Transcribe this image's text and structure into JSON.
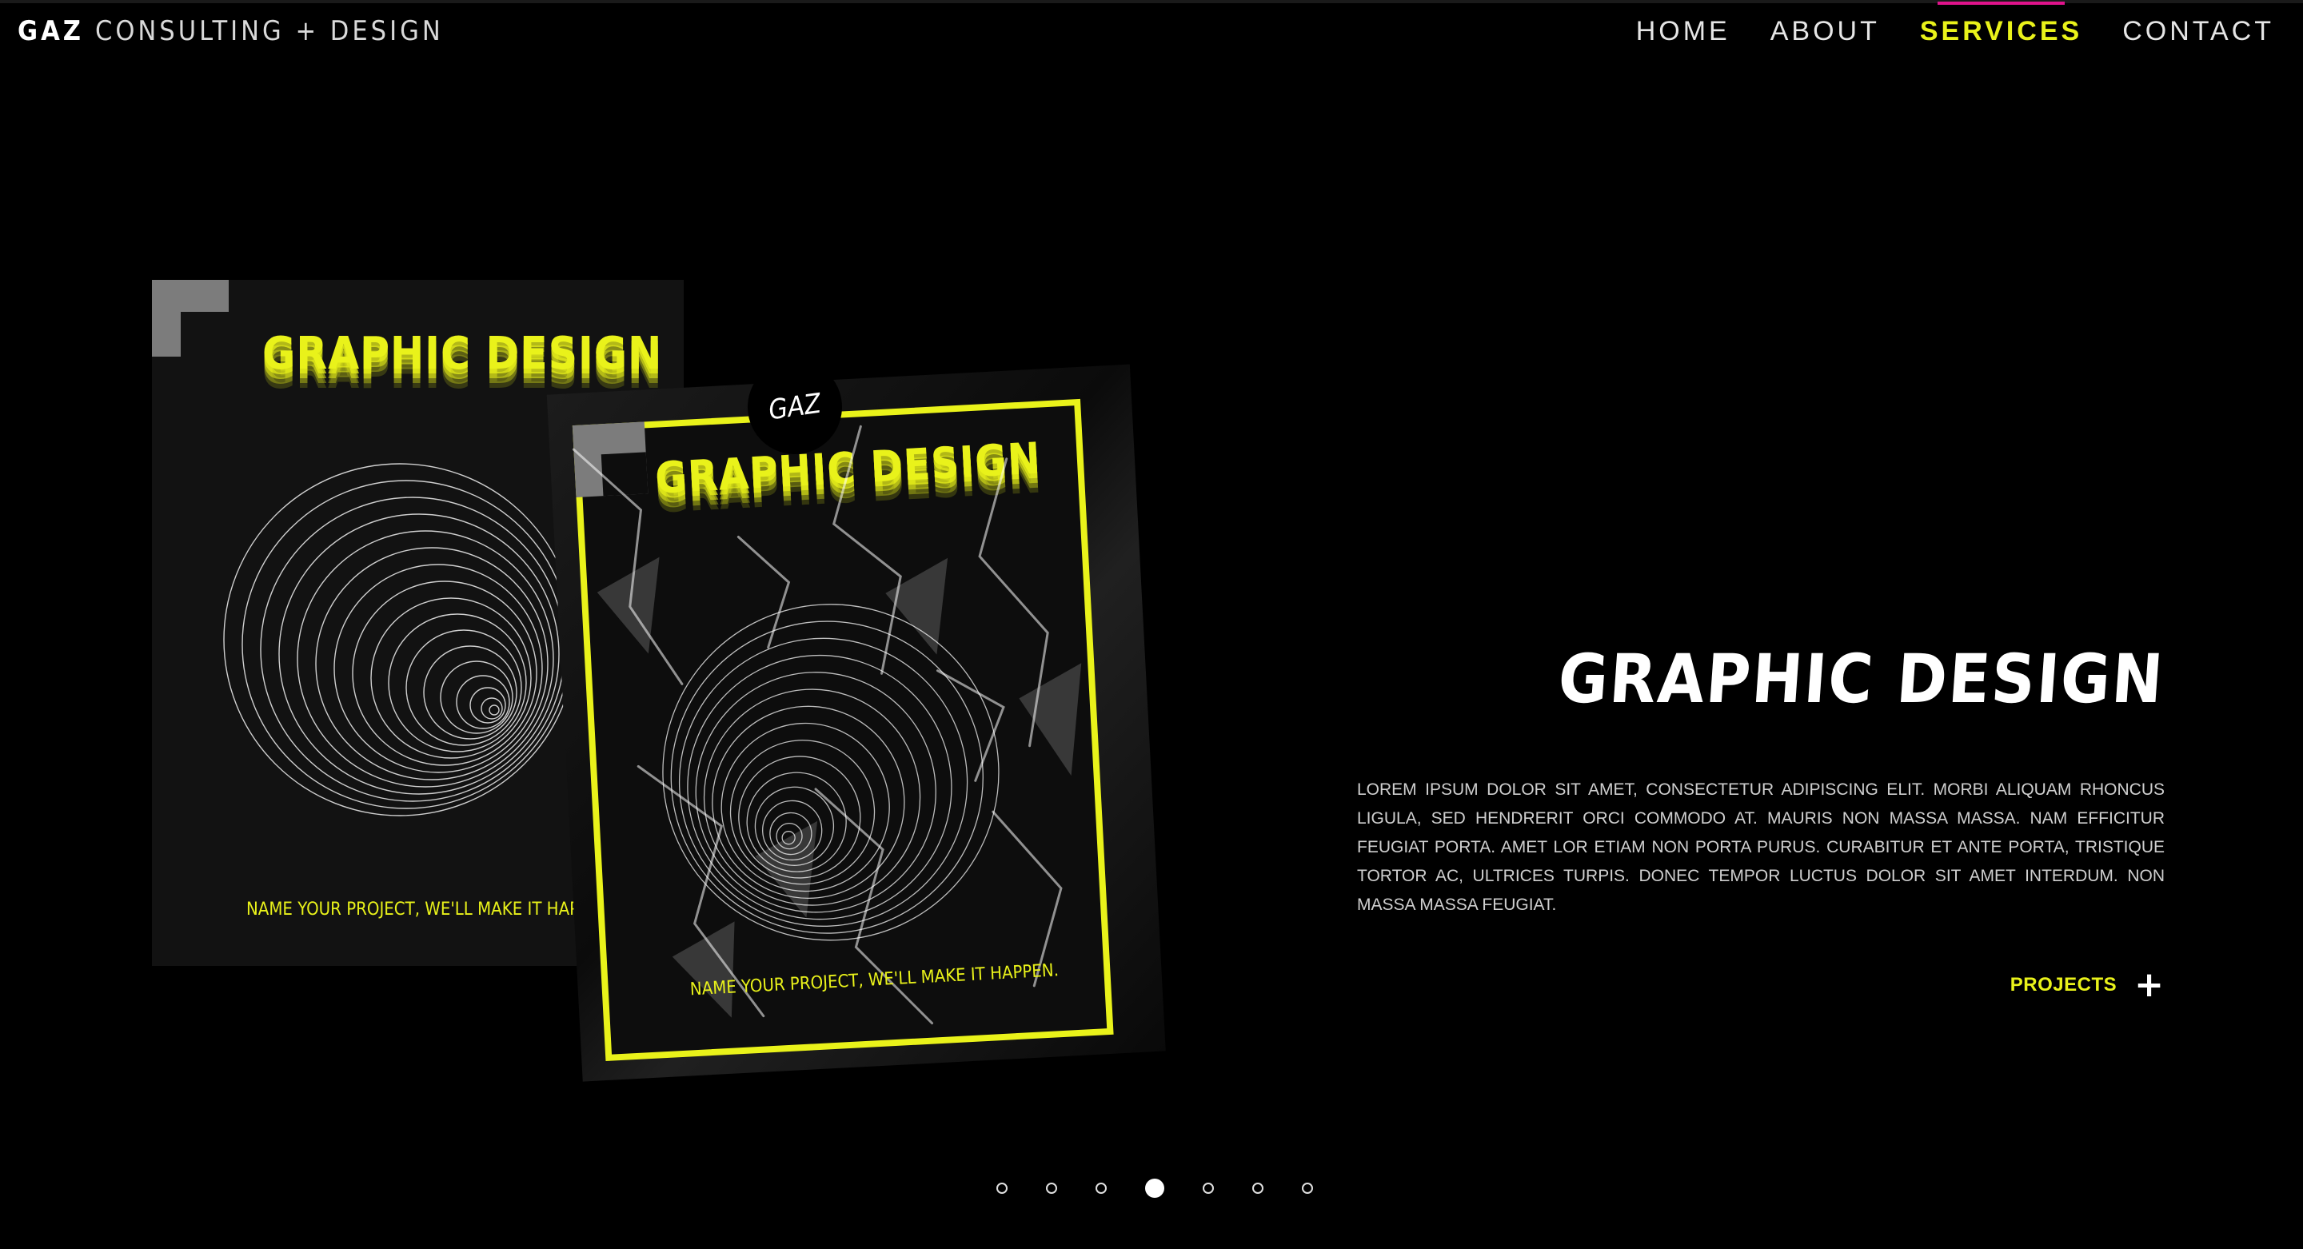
{
  "header": {
    "brand_bold": "GAZ",
    "brand_rest": "CONSULTING + DESIGN",
    "nav": [
      {
        "label": "HOME",
        "active": false
      },
      {
        "label": "ABOUT",
        "active": false
      },
      {
        "label": "SERVICES",
        "active": true
      },
      {
        "label": "CONTACT",
        "active": false
      }
    ]
  },
  "artwork": {
    "back_poster": {
      "title": "GRAPHIC DESIGN",
      "tagline": "NAME YOUR PROJECT, WE'LL MAKE IT HAPPEN."
    },
    "front_poster": {
      "title": "GRAPHIC DESIGN",
      "tagline": "NAME YOUR PROJECT, WE'LL MAKE IT HAPPEN.",
      "badge": "GAZ"
    }
  },
  "service": {
    "title": "GRAPHIC DESIGN",
    "description": "LOREM IPSUM DOLOR SIT AMET, CONSECTETUR ADIPISCING ELIT. MORBI ALIQUAM RHONCUS LIGULA, SED HENDRERIT ORCI COMMODO AT. MAURIS NON MASSA MASSA. NAM EFFICITUR FEUGIAT PORTA. AMET LOR  ETIAM NON PORTA PURUS. CURABITUR ET ANTE PORTA, TRISTIQUE TORTOR AC, ULTRICES TURPIS. DONEC TEMPOR LUCTUS DOLOR SIT AMET INTERDUM. NON MASSA MASSA FEUGIAT.",
    "projects_label": "PROJECTS",
    "projects_icon": "plus-icon"
  },
  "pager": {
    "total": 7,
    "active_index": 3
  },
  "colors": {
    "accent_yellow": "#e9f21a",
    "accent_magenta": "#e0138c",
    "background": "#000000"
  }
}
